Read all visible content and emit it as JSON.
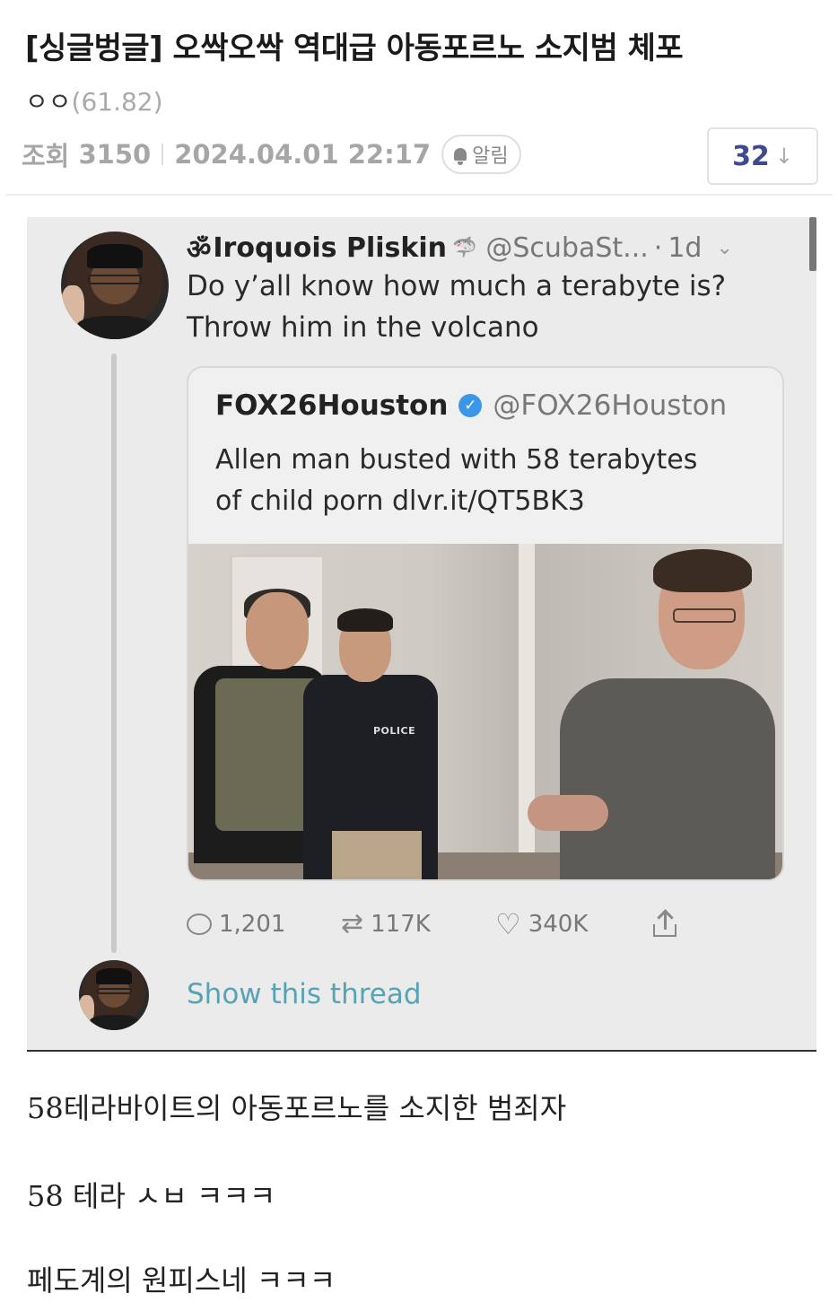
{
  "post": {
    "title": "[싱글벙글] 오싹오싹 역대급 아동포르노 소지범 체포",
    "author": "ㅇㅇ",
    "author_score": "(61.82)",
    "views_label": "조회",
    "views": "3150",
    "date": "2024.04.01 22:17",
    "notify_label": "알림",
    "comment_count": "32",
    "comment_arrow": "↓"
  },
  "tweet": {
    "name_prefix": "ॐ",
    "name": "Iroquois Pliskin",
    "name_emoji": "🦈",
    "handle": "@ScubaSt...",
    "dot": "·",
    "time": "1d",
    "menu": "⌄",
    "text": "Do y’all know how much a terabyte is?\nThrow him in the volcano",
    "quote": {
      "name": "FOX26Houston",
      "verified_mark": "✓",
      "handle": "@FOX26Houston",
      "text": "Allen man busted with 58 terabytes\nof child porn dlvr.it/QT5BK3",
      "photo_label": "POLICE"
    },
    "replies": "1,201",
    "retweets": "117K",
    "likes": "340K",
    "show_thread": "Show this thread"
  },
  "body": {
    "line1": "58테라바이트의 아동포르노를 소지한 범죄자",
    "line2": "58 테라 ㅅㅂ ㅋㅋㅋ",
    "line3": "페도계의 원피스네 ㅋㅋㅋ"
  },
  "colors": {
    "comment_count": "#3d4a8f",
    "link": "#57a3b4",
    "verified": "#3a97e8",
    "tweet_bg": "#ebebeb"
  }
}
